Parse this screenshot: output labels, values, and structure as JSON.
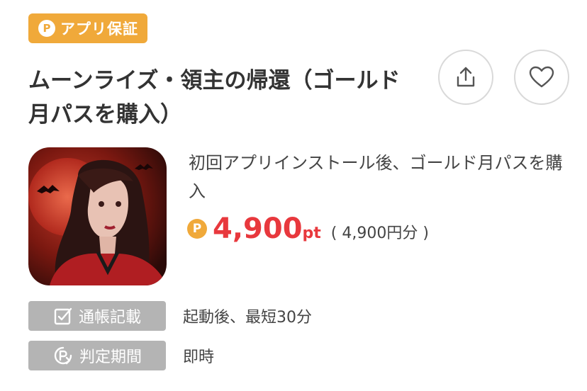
{
  "badge": {
    "coin": "P",
    "label": "アプリ保証"
  },
  "title": "ムーンライズ・領主の帰還（ゴールド月パスを購入）",
  "actions": {
    "share_icon": "share-icon",
    "favorite_icon": "heart-icon"
  },
  "offer": {
    "description": "初回アプリインストール後、ゴールド月パスを購入",
    "coin": "P",
    "points": "4,900",
    "points_unit": "pt",
    "yen_equivalent": "( 4,900円分 )"
  },
  "info": [
    {
      "label": "通帳記載",
      "value": "起動後、最短30分",
      "icon": "check-icon"
    },
    {
      "label": "判定期間",
      "value": "即時",
      "icon": "point-clock-icon"
    }
  ],
  "colors": {
    "accent": "#f0a93a",
    "price": "#e8383d",
    "tag_bg": "#b4b4b4"
  }
}
